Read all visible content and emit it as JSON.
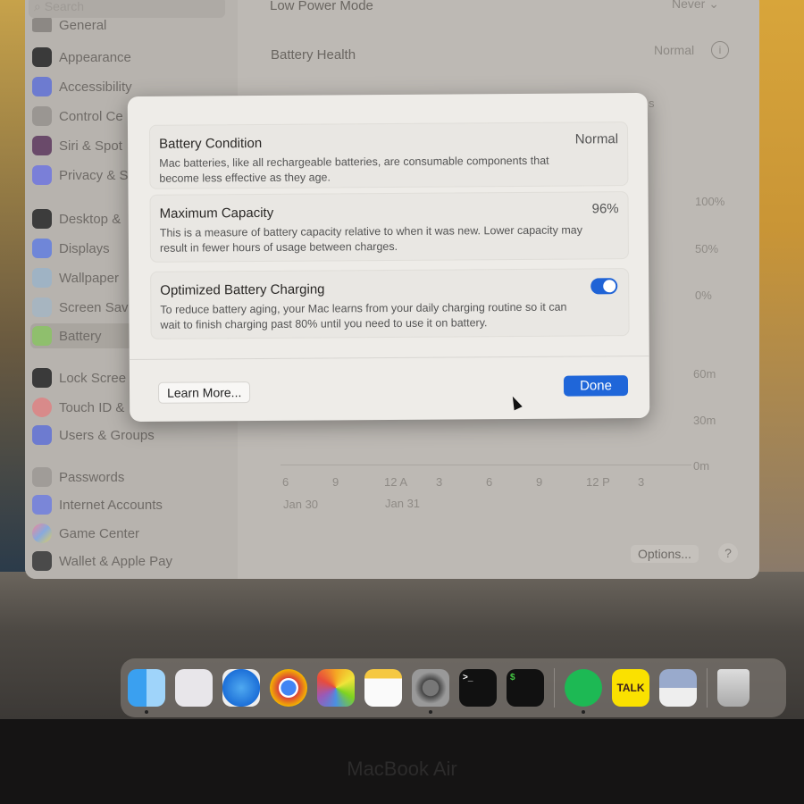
{
  "device": {
    "brand": "MacBook Air"
  },
  "sidebar": {
    "search_placeholder": "Search",
    "items": [
      {
        "label": "General",
        "icon": "gear-icon"
      },
      {
        "label": "Appearance",
        "icon": "appearance-icon"
      },
      {
        "label": "Accessibility",
        "icon": "accessibility-icon"
      },
      {
        "label": "Control Ce",
        "icon": "control-center-icon"
      },
      {
        "label": "Siri & Spot",
        "icon": "siri-icon"
      },
      {
        "label": "Privacy & S",
        "icon": "hand-icon"
      },
      {
        "label": "Desktop &",
        "icon": "desktop-icon"
      },
      {
        "label": "Displays",
        "icon": "displays-icon"
      },
      {
        "label": "Wallpaper",
        "icon": "wallpaper-icon"
      },
      {
        "label": "Screen Sav",
        "icon": "screensaver-icon"
      },
      {
        "label": "Battery",
        "icon": "battery-icon",
        "selected": true
      },
      {
        "label": "Lock Scree",
        "icon": "lock-icon"
      },
      {
        "label": "Touch ID &",
        "icon": "fingerprint-icon"
      },
      {
        "label": "Users & Groups",
        "icon": "users-icon"
      },
      {
        "label": "Passwords",
        "icon": "key-icon"
      },
      {
        "label": "Internet Accounts",
        "icon": "at-icon"
      },
      {
        "label": "Game Center",
        "icon": "game-center-icon"
      },
      {
        "label": "Wallet & Apple Pay",
        "icon": "wallet-icon"
      }
    ]
  },
  "main": {
    "low_power_mode": {
      "label": "Low Power Mode",
      "value": "Never"
    },
    "battery_health": {
      "label": "Battery Health",
      "value": "Normal"
    },
    "segment_fragment": "s",
    "chart_axis": {
      "level_ticks": [
        "100%",
        "50%",
        "0%"
      ],
      "usage_ticks": [
        "60m",
        "30m",
        "0m"
      ],
      "time_ticks": [
        "6",
        "9",
        "12 A",
        "3",
        "6",
        "9",
        "12 P",
        "3"
      ],
      "dates": [
        "Jan 30",
        "Jan 31"
      ]
    },
    "options_label": "Options...",
    "help_label": "?"
  },
  "dialog": {
    "battery_condition": {
      "title": "Battery Condition",
      "value": "Normal",
      "description": "Mac batteries, like all rechargeable batteries, are consumable components that become less effective as they age."
    },
    "maximum_capacity": {
      "title": "Maximum Capacity",
      "value": "96%",
      "description": "This is a measure of battery capacity relative to when it was new. Lower capacity may result in fewer hours of usage between charges."
    },
    "optimized_charging": {
      "title": "Optimized Battery Charging",
      "enabled": true,
      "description": "To reduce battery aging, your Mac learns from your daily charging routine so it can wait to finish charging past 80% until you need to use it on battery."
    },
    "learn_more": "Learn More...",
    "done": "Done",
    "accent": "#1f66d9"
  },
  "dock": {
    "kakao_label": "TALK",
    "apps": [
      "Finder",
      "Launchpad",
      "Safari",
      "Chrome",
      "Photos",
      "Notes",
      "System Settings",
      "Terminal",
      "Terminal",
      "Spotify",
      "KakaoTalk",
      "Preview",
      "Trash"
    ]
  }
}
